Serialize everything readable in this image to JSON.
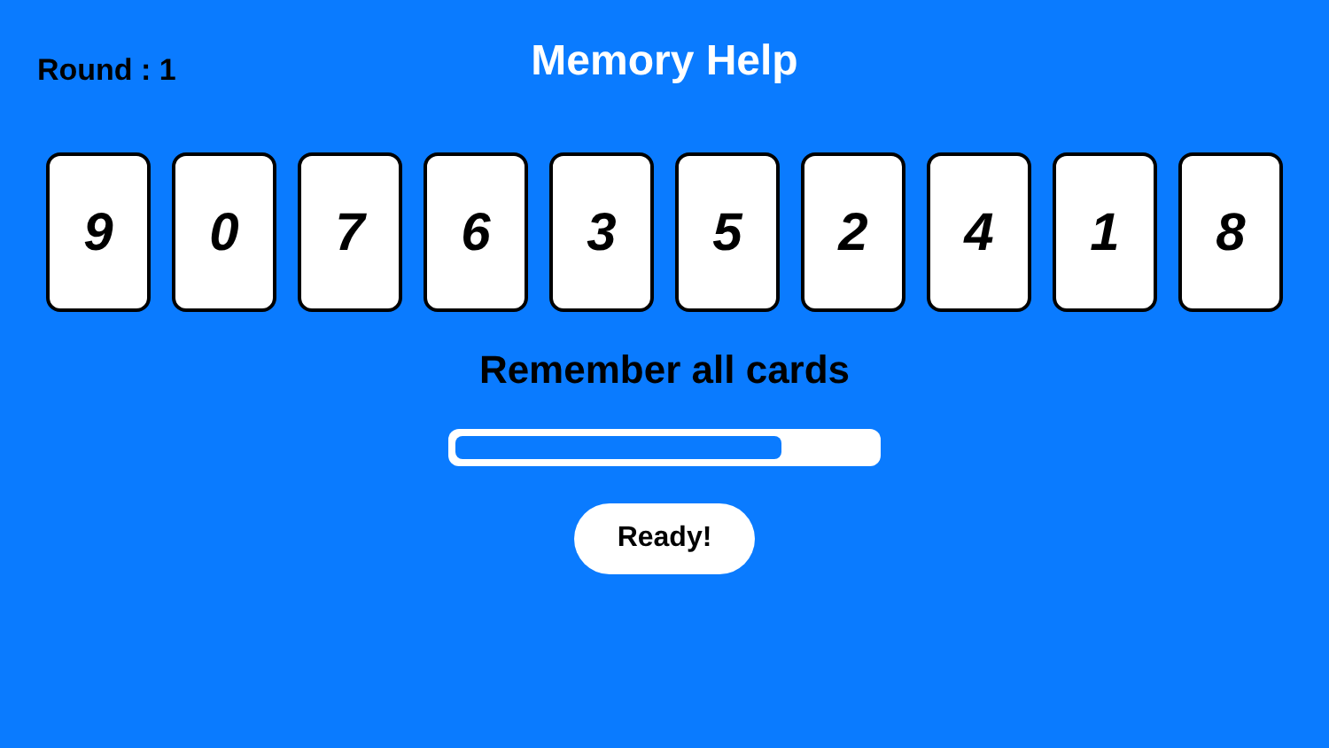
{
  "round_label": "Round : 1",
  "title": "Memory Help",
  "cards": [
    "9",
    "0",
    "7",
    "6",
    "3",
    "5",
    "2",
    "4",
    "1",
    "8"
  ],
  "instruction": "Remember all cards",
  "timer": {
    "level": 0.78
  },
  "button": "Ready!"
}
